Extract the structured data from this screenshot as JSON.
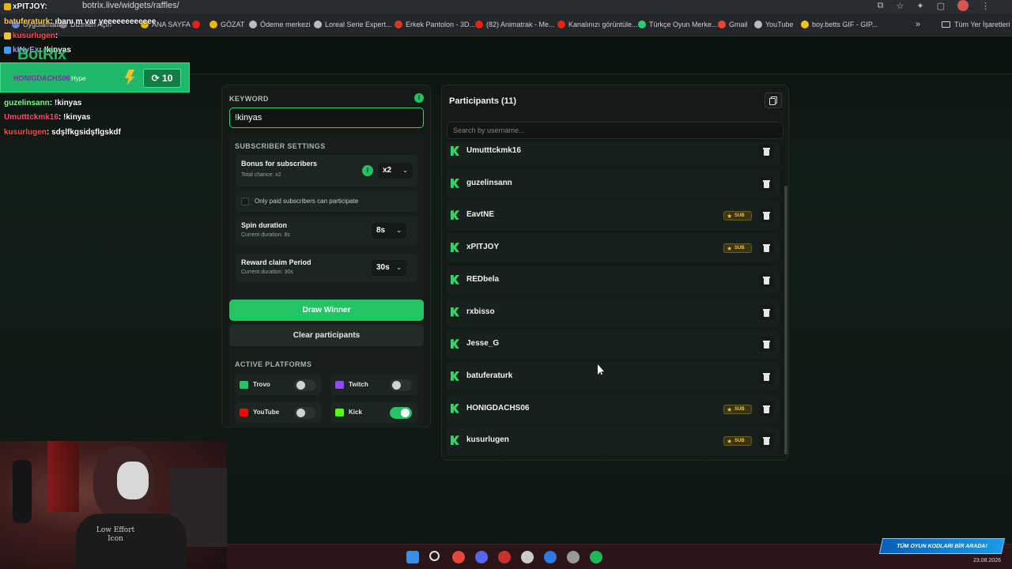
{
  "browser": {
    "url": "botrix.live/widgets/raffles/",
    "bookmarks": [
      {
        "label": "Uygulamalar",
        "color": "#5f8fd8"
      },
      {
        "label": "Dizinleri Açın",
        "color": "#888888"
      },
      {
        "label": "ANA SAYFA",
        "color": "#e6b800"
      },
      {
        "label": "",
        "color": "#e62117"
      },
      {
        "label": "GÖZAT",
        "color": "#e6b800"
      },
      {
        "label": "Ödeme merkezi",
        "color": "#bbbbbb"
      },
      {
        "label": "Loreal Serie Expert...",
        "color": "#bbbbbb"
      },
      {
        "label": "Erkek Pantolon - 3D...",
        "color": "#d33a2c"
      },
      {
        "label": "(82) Animatrak - Me...",
        "color": "#e62117"
      },
      {
        "label": "Kanalınızı görüntüle...",
        "color": "#e62117"
      },
      {
        "label": "Türkçe Oyun Merke...",
        "color": "#2ecc71"
      },
      {
        "label": "Gmail",
        "color": "#ea4335"
      },
      {
        "label": "YouTube",
        "color": "#bbbbbb"
      },
      {
        "label": "boy.betts GIF - GIP...",
        "color": "#f1c40f"
      }
    ],
    "chevron": "»",
    "all_bookmarks": "Tüm Yer İşaretleri"
  },
  "overlay": {
    "logo": "BotRix",
    "chat_top": [
      {
        "user": "xPITJOY",
        "text": ":",
        "color": "#ffffff",
        "emote_color": "#e6b800"
      },
      {
        "user": "batuferaturk",
        "text": ": ıbanı m var yeeeeeeeeeeee",
        "color": "#ffd24a",
        "emote_color": ""
      },
      {
        "user": "kusurlugen",
        "text": ":",
        "color": "#ff4b4b",
        "emote_color": "#f2c230"
      },
      {
        "user": "kINyEx",
        "text": ": !kinyas",
        "color": "#b38cff",
        "emote_color": "#3aa1ff"
      }
    ],
    "hype": {
      "name": "HONIGDACHS06",
      "label": "Hype",
      "count": "10",
      "count_icon": "⟳"
    },
    "chat_bottom": [
      {
        "user": "guzelinsann",
        "text": ": !kinyas",
        "color": "#7dff7d"
      },
      {
        "user": "Umutttckmk16",
        "text": ": !kinyas",
        "color": "#ff4d6d"
      },
      {
        "user": "kusurlugen",
        "text": ": sdşlfkgsidşflgskdf",
        "color": "#ff4b4b"
      }
    ]
  },
  "settings": {
    "keyword_label": "KEYWORD",
    "keyword_value": "!kinyas",
    "info_icon": "i",
    "subscriber_settings_label": "SUBSCRIBER SETTINGS",
    "bonus": {
      "title": "Bonus for subscribers",
      "subtitle": "Total chance: x2",
      "value": "x2"
    },
    "paid_only": {
      "label": "Only paid subscribers can participate",
      "checked": false
    },
    "spin": {
      "title": "Spin duration",
      "subtitle": "Current duration: 8s",
      "value": "8s"
    },
    "reward": {
      "title": "Reward claim Period",
      "subtitle": "Current duration: 30s",
      "value": "30s"
    },
    "draw_button": "Draw Winner",
    "clear_button": "Clear participants",
    "platforms_label": "ACTIVE PLATFORMS",
    "platforms": [
      {
        "name": "Trovo",
        "enabled": false,
        "color": "#22c463"
      },
      {
        "name": "Twitch",
        "enabled": false,
        "color": "#9146ff"
      },
      {
        "name": "YouTube",
        "enabled": false,
        "color": "#ff0000"
      },
      {
        "name": "Kick",
        "enabled": true,
        "color": "#53fc18"
      }
    ]
  },
  "participants": {
    "title": "Participants (11)",
    "search_placeholder": "Search by username...",
    "sub_badge": "SUB",
    "list": [
      {
        "name": "Umutttckmk16",
        "sub": false
      },
      {
        "name": "guzelinsann",
        "sub": false
      },
      {
        "name": "EavtNE",
        "sub": true
      },
      {
        "name": "xPITJOY",
        "sub": true
      },
      {
        "name": "REDbela",
        "sub": false
      },
      {
        "name": "rxbisso",
        "sub": false
      },
      {
        "name": "Jesse_G",
        "sub": false
      },
      {
        "name": "batuferaturk",
        "sub": false
      },
      {
        "name": "HONIGDACHS06",
        "sub": true
      },
      {
        "name": "kusurlugen",
        "sub": true
      }
    ]
  },
  "webcam": {
    "shirt_text": "Low Effort Icon"
  },
  "taskbar": {
    "promo": "TÜM OYUN KODLARI BİR ARADA!",
    "date": "23.08.2026"
  }
}
